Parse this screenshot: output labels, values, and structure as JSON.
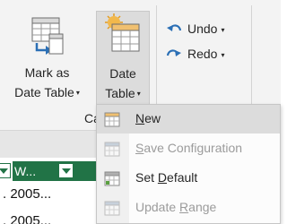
{
  "ribbon": {
    "mark_as_date_table": {
      "line1": "Mark as",
      "line2": "Date Table",
      "caret": "▾"
    },
    "date_table": {
      "line1": "Date",
      "line2": "Table",
      "caret": "▾"
    },
    "undo": {
      "label": "Undo",
      "caret": "▾"
    },
    "redo": {
      "label": "Redo",
      "caret": "▾"
    },
    "group_label": "Calend"
  },
  "date_table_menu": {
    "items": [
      {
        "label": "New",
        "enabled": true,
        "accelerator": "N",
        "icon": "calendar-new-icon"
      },
      {
        "label": "Save Configuration",
        "enabled": false,
        "accelerator": "S",
        "icon": "calendar-save-icon"
      },
      {
        "label": "Set Default",
        "enabled": true,
        "accelerator": "D",
        "icon": "calendar-default-icon"
      },
      {
        "label": "Update Range",
        "enabled": false,
        "accelerator": "R",
        "icon": "calendar-range-icon"
      }
    ]
  },
  "sheet": {
    "headers": [
      "W..."
    ],
    "cells": [
      ". 2005...",
      ". 2005..."
    ]
  },
  "colors": {
    "ribbon_bg": "#f3f3f3",
    "accent_green": "#217346",
    "pressed_button": "#dcdcdc",
    "disabled_text": "#9b9b9b"
  }
}
